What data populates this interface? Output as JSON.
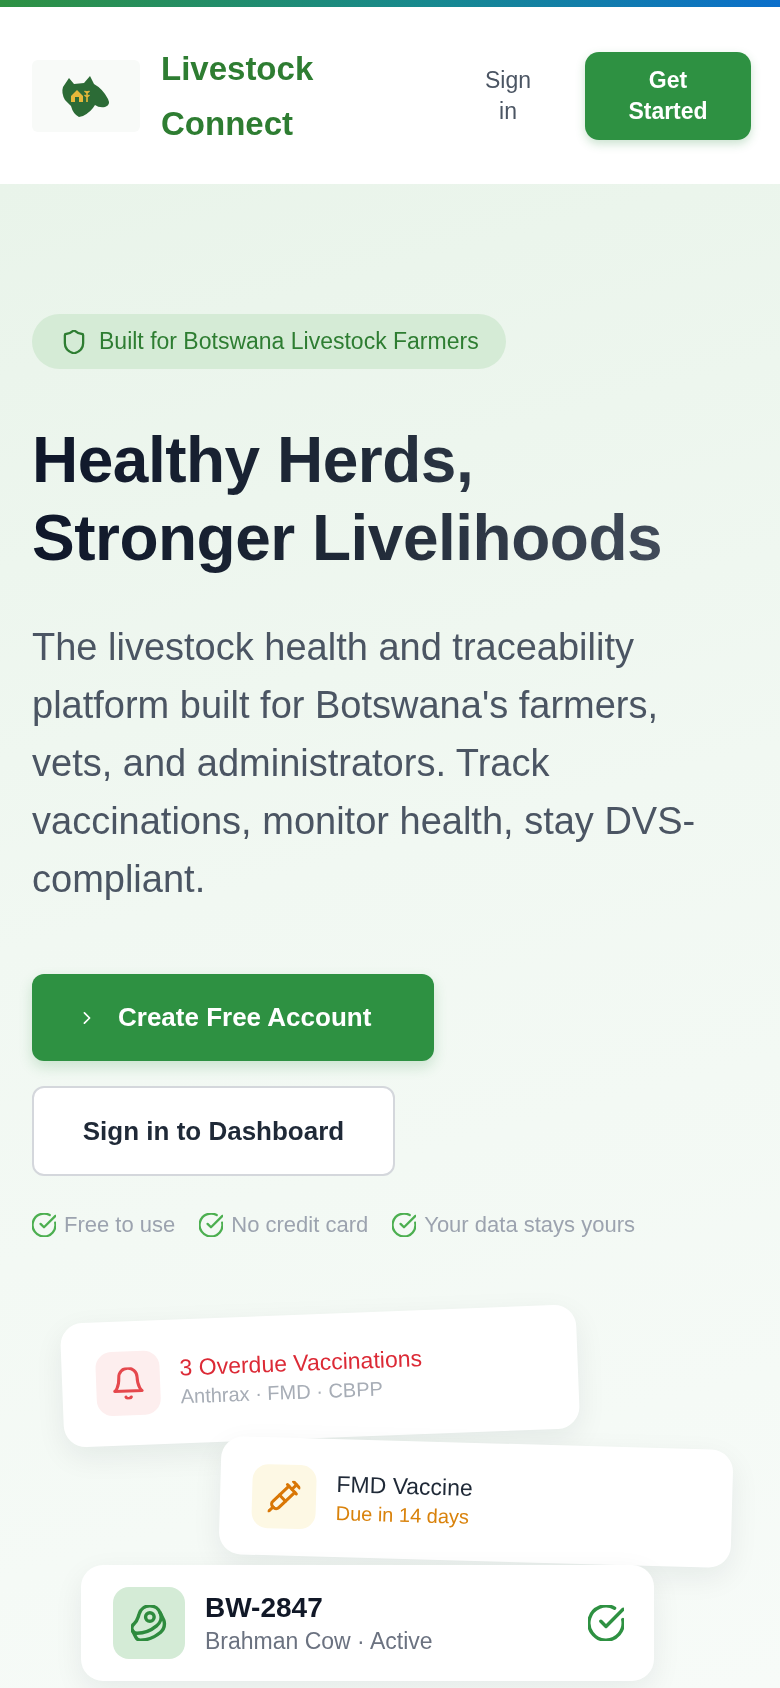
{
  "header": {
    "brand": "Livestock Connect",
    "sign_in": "Sign in",
    "cta": "Get Started"
  },
  "hero": {
    "badge": "Built for Botswana Livestock Farmers",
    "title": "Healthy Herds, Stronger Livelihoods",
    "description": "The livestock health and traceability platform built for Botswana's farmers, vets, and administrators. Track vaccinations, monitor health, stay DVS-compliant.",
    "buttons": [
      {
        "label": "Create Free Account",
        "kind": "primary"
      },
      {
        "label": "Sign in to Dashboard",
        "kind": "secondary"
      }
    ],
    "perks": [
      "Free to use",
      "No credit card",
      "Your data stays yours"
    ]
  },
  "preview_cards": [
    {
      "kind": "alert",
      "title": "3 Overdue Vaccinations",
      "subtitle": "Anthrax · FMD · CBPP",
      "verified": false
    },
    {
      "kind": "reminder",
      "title": "FMD Vaccine",
      "subtitle": "Due in 14 days",
      "verified": false
    },
    {
      "kind": "animal",
      "title": "BW-2847",
      "subtitle": "Brahman Cow · Active",
      "verified": true
    }
  ]
}
